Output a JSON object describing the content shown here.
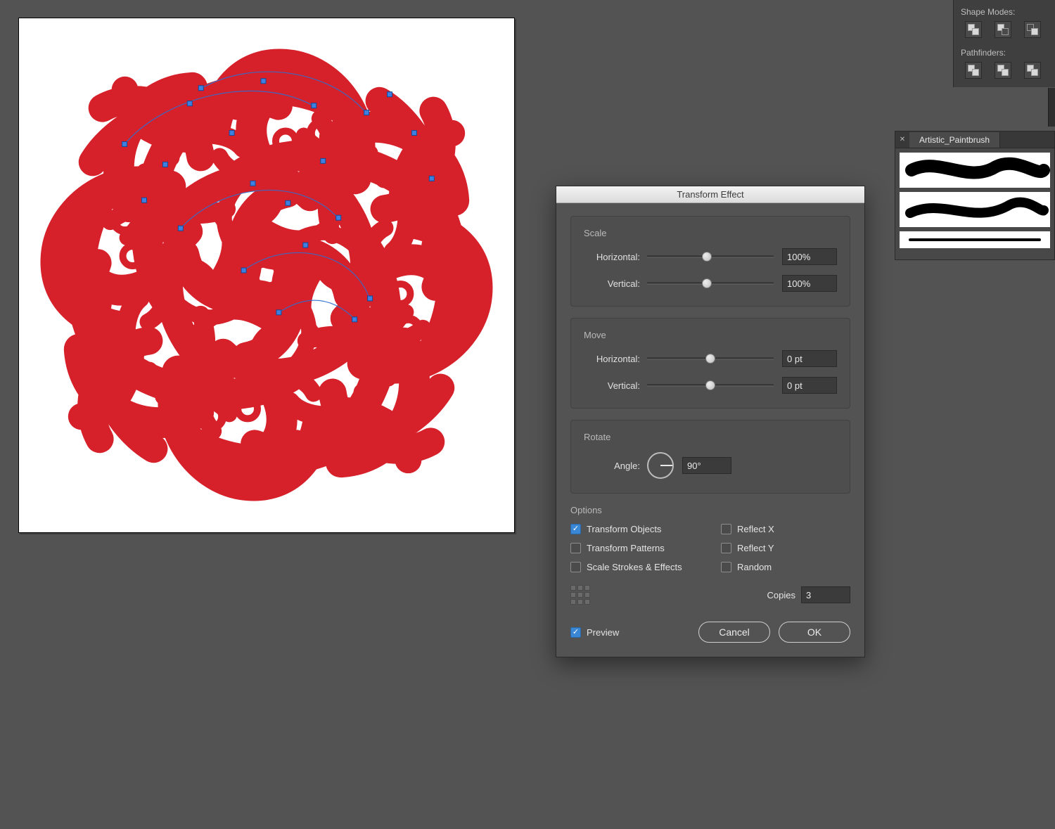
{
  "pathfinder": {
    "shape_modes_label": "Shape Modes:",
    "pathfinders_label": "Pathfinders:"
  },
  "brushes_panel": {
    "tab_label": "Artistic_Paintbrush"
  },
  "dialog": {
    "title": "Transform Effect",
    "scale": {
      "title": "Scale",
      "horizontal_label": "Horizontal:",
      "horizontal_value": "100%",
      "vertical_label": "Vertical:",
      "vertical_value": "100%"
    },
    "move": {
      "title": "Move",
      "horizontal_label": "Horizontal:",
      "horizontal_value": "0 pt",
      "vertical_label": "Vertical:",
      "vertical_value": "0 pt"
    },
    "rotate": {
      "title": "Rotate",
      "angle_label": "Angle:",
      "angle_value": "90°"
    },
    "options": {
      "title": "Options",
      "transform_objects": "Transform Objects",
      "reflect_x": "Reflect X",
      "transform_patterns": "Transform Patterns",
      "reflect_y": "Reflect Y",
      "scale_strokes": "Scale Strokes & Effects",
      "random": "Random",
      "copies_label": "Copies",
      "copies_value": "3"
    },
    "preview_label": "Preview",
    "cancel_label": "Cancel",
    "ok_label": "OK",
    "checked": {
      "transform_objects": true,
      "transform_patterns": false,
      "scale_strokes": false,
      "reflect_x": false,
      "reflect_y": false,
      "random": false,
      "preview": true
    }
  }
}
